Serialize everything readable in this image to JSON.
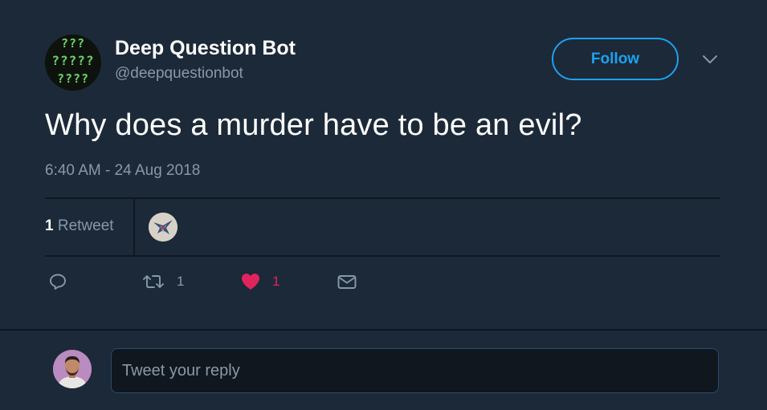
{
  "tweet": {
    "author": {
      "display_name": "Deep Question Bot",
      "handle": "@deepquestionbot",
      "avatar_rows": [
        "???",
        "?????",
        "????"
      ],
      "avatar_icon": "question-marks-avatar"
    },
    "follow_label": "Follow",
    "text": "Why does a murder have to be an evil?",
    "timestamp": "6:40 AM - 24 Aug 2018",
    "stats": {
      "retweet_count": "1",
      "retweet_label": "Retweet"
    },
    "actions": {
      "reply": {
        "icon": "reply-icon"
      },
      "retweet": {
        "icon": "retweet-icon",
        "count": "1"
      },
      "like": {
        "icon": "heart-icon",
        "count": "1",
        "active": true
      },
      "message": {
        "icon": "envelope-icon"
      }
    }
  },
  "reply": {
    "placeholder": "Tweet your reply"
  },
  "colors": {
    "background": "#1c2938",
    "accent": "#1da1f2",
    "like": "#e0245e",
    "muted_text": "#8899a6",
    "divider": "#10171e"
  }
}
